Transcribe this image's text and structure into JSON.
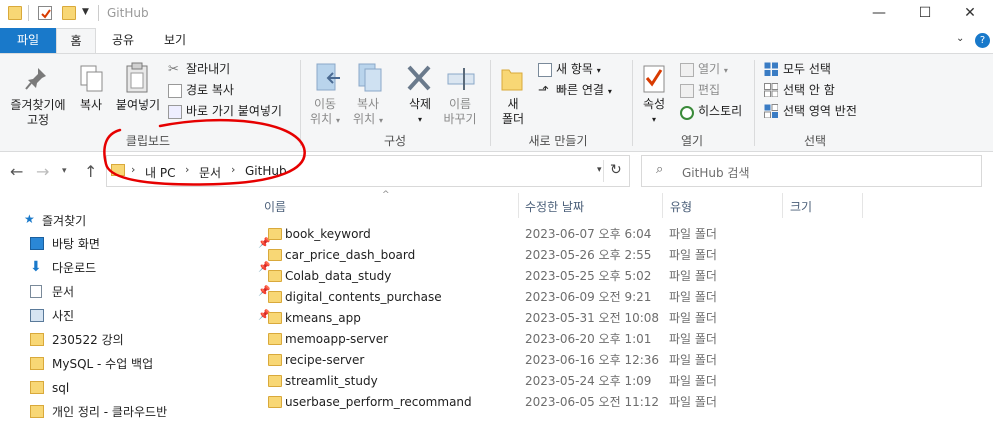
{
  "window": {
    "title": "GitHub",
    "controls": {
      "minimize": "—",
      "maximize": "☐",
      "close": "✕"
    }
  },
  "tabs": [
    {
      "label": "파일"
    },
    {
      "label": "홈"
    },
    {
      "label": "공유"
    },
    {
      "label": "보기"
    }
  ],
  "ribbon": {
    "clipboard": {
      "pin_label_1": "즐겨찾기에",
      "pin_label_2": "고정",
      "copy": "복사",
      "paste": "붙여넣기",
      "cut": "잘라내기",
      "copy_path": "경로 복사",
      "paste_shortcut": "바로 가기 붙여넣기",
      "group": "클립보드"
    },
    "organize": {
      "move_to_1": "이동",
      "move_to_2": "위치",
      "copy_to_1": "복사",
      "copy_to_2": "위치",
      "delete": "삭제",
      "rename_1": "이름",
      "rename_2": "바꾸기",
      "group": "구성"
    },
    "new": {
      "new_folder_1": "새",
      "new_folder_2": "폴더",
      "new_item": "새 항목",
      "easy_access": "빠른 연결",
      "group": "새로 만들기"
    },
    "open": {
      "properties": "속성",
      "open": "열기",
      "edit": "편집",
      "history": "히스토리",
      "group": "열기"
    },
    "select": {
      "select_all": "모두 선택",
      "select_none": "선택 안 함",
      "invert": "선택 영역 반전",
      "group": "선택"
    }
  },
  "address": {
    "breadcrumbs": [
      "내 PC",
      "문서",
      "GitHub"
    ],
    "search_placeholder": "GitHub 검색"
  },
  "nav": {
    "quick_access": "즐겨찾기",
    "items": [
      {
        "label": "바탕 화면",
        "pinned": true
      },
      {
        "label": "다운로드",
        "pinned": true
      },
      {
        "label": "문서",
        "pinned": true
      },
      {
        "label": "사진",
        "pinned": true
      },
      {
        "label": "230522 강의",
        "pinned": false
      },
      {
        "label": "MySQL - 수업 백업",
        "pinned": false
      },
      {
        "label": "sql",
        "pinned": false
      },
      {
        "label": "개인 정리 - 클라우드반",
        "pinned": false
      }
    ]
  },
  "list": {
    "columns": {
      "name": "이름",
      "date": "수정한 날짜",
      "type": "유형",
      "size": "크기"
    },
    "rows": [
      {
        "name": "book_keyword",
        "date": "2023-06-07 오후 6:04",
        "type": "파일 폴더"
      },
      {
        "name": "car_price_dash_board",
        "date": "2023-05-26 오후 2:55",
        "type": "파일 폴더"
      },
      {
        "name": "Colab_data_study",
        "date": "2023-05-25 오후 5:02",
        "type": "파일 폴더"
      },
      {
        "name": "digital_contents_purchase",
        "date": "2023-06-09 오전 9:21",
        "type": "파일 폴더"
      },
      {
        "name": "kmeans_app",
        "date": "2023-05-31 오전 10:08",
        "type": "파일 폴더"
      },
      {
        "name": "memoapp-server",
        "date": "2023-06-20 오후 1:01",
        "type": "파일 폴더"
      },
      {
        "name": "recipe-server",
        "date": "2023-06-16 오후 12:36",
        "type": "파일 폴더"
      },
      {
        "name": "streamlit_study",
        "date": "2023-05-24 오후 1:09",
        "type": "파일 폴더"
      },
      {
        "name": "userbase_perform_recommand",
        "date": "2023-06-05 오전 11:12",
        "type": "파일 폴더"
      }
    ]
  },
  "colors": {
    "accent": "#1979ca",
    "annotation": "#e60000",
    "folder": "#f8d775"
  }
}
